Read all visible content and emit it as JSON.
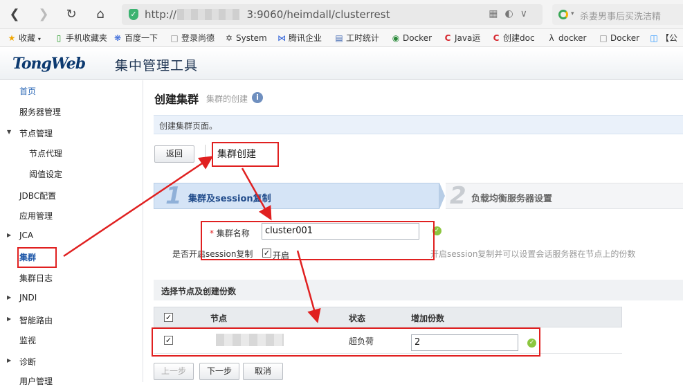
{
  "browser": {
    "url": "http://1",
    "url_tail": "3:9060/heimdall/clusterrest",
    "search_placeholder": "杀妻男事后买洗洁精",
    "bookmarks": [
      "收藏",
      "手机收藏夹",
      "百度一下",
      "登录尚德",
      "System",
      "腾讯企业",
      "工时统计",
      "Docker",
      "Java运",
      "创建doc",
      "docker",
      "Docker",
      "【公"
    ]
  },
  "app": {
    "brand": "TongWeb",
    "title": "集中管理工具"
  },
  "sidebar": {
    "items": [
      {
        "label": "首页"
      },
      {
        "label": "服务器管理"
      },
      {
        "label": "节点管理"
      },
      {
        "label": "节点代理"
      },
      {
        "label": "阈值设定"
      },
      {
        "label": "JDBC配置"
      },
      {
        "label": "应用管理"
      },
      {
        "label": "JCA"
      },
      {
        "label": "集群"
      },
      {
        "label": "集群日志"
      },
      {
        "label": "JNDI"
      },
      {
        "label": "智能路由"
      },
      {
        "label": "监视"
      },
      {
        "label": "诊断"
      },
      {
        "label": "用户管理"
      }
    ]
  },
  "page": {
    "title": "创建集群",
    "subtitle": "集群的创建",
    "description": "创建集群页面。",
    "back_label": "返回",
    "callout": "集群创建"
  },
  "steps": [
    {
      "num": "1",
      "label": "集群及session复制"
    },
    {
      "num": "2",
      "label": "负载均衡服务器设置"
    }
  ],
  "form": {
    "cluster_name_label": "集群名称",
    "cluster_name_value": "cluster001",
    "session_label": "是否开启session复制",
    "session_checkbox_label": "开启",
    "session_checked": true,
    "session_hint": "开启session复制并可以设置会话服务器在节点上的份数"
  },
  "nodes_section": {
    "title": "选择节点及创建份数",
    "columns": [
      "节点",
      "状态",
      "增加份数"
    ],
    "rows": [
      {
        "checked": true,
        "status": "超负荷",
        "copies": "2"
      }
    ]
  },
  "footer_buttons": {
    "prev": "上一步",
    "next": "下一步",
    "cancel": "取消"
  },
  "colors": {
    "highlight_red": "#e02020",
    "active_blue": "#1c56a8",
    "step_blue": "#d5e4f6"
  }
}
